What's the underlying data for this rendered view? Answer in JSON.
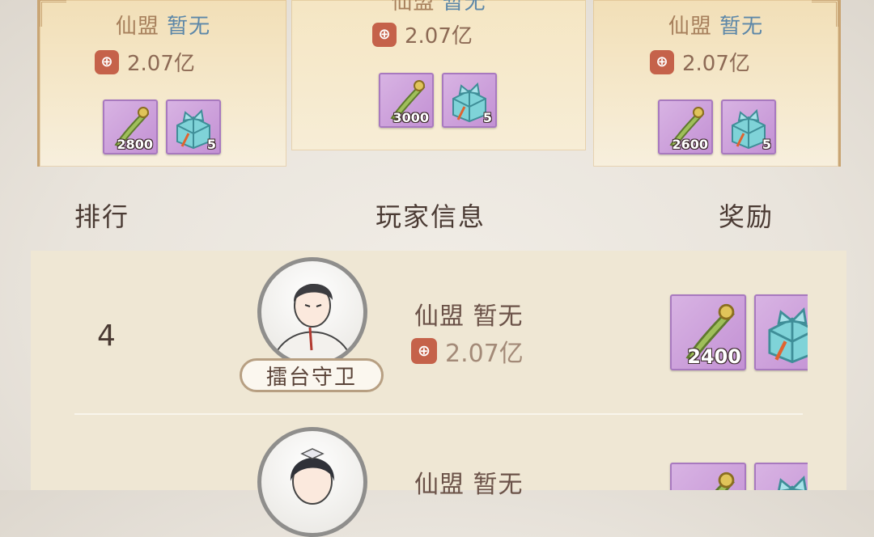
{
  "top_cards": [
    {
      "guild_label": "仙盟",
      "guild_value": "暂无",
      "power": "2.07亿",
      "rewards": [
        {
          "icon": "scroll-icon",
          "count": "2800"
        },
        {
          "icon": "gift-box-icon",
          "count": "5"
        }
      ]
    },
    {
      "guild_label": "仙盟",
      "guild_value": "暂无",
      "power": "2.07亿",
      "rewards": [
        {
          "icon": "scroll-icon",
          "count": "3000"
        },
        {
          "icon": "gift-box-icon",
          "count": "5"
        }
      ]
    },
    {
      "guild_label": "仙盟",
      "guild_value": "暂无",
      "power": "2.07亿",
      "rewards": [
        {
          "icon": "scroll-icon",
          "count": "2600"
        },
        {
          "icon": "gift-box-icon",
          "count": "5"
        }
      ]
    }
  ],
  "headers": {
    "rank": "排行",
    "player_info": "玩家信息",
    "reward": "奖励"
  },
  "rows": [
    {
      "rank": "4",
      "title": "擂台守卫",
      "guild_label": "仙盟",
      "guild_value": "暂无",
      "power": "2.07亿",
      "rewards": [
        {
          "icon": "scroll-icon",
          "count": "2400"
        },
        {
          "icon": "gift-box-icon",
          "count": ""
        }
      ]
    },
    {
      "guild_label": "仙盟",
      "guild_value": "暂无"
    }
  ],
  "power_icon_glyph": "⊕",
  "colors": {
    "guild_value": "#5c87a8",
    "power_icon": "#c5624a",
    "item_bg": "#c391d4"
  }
}
